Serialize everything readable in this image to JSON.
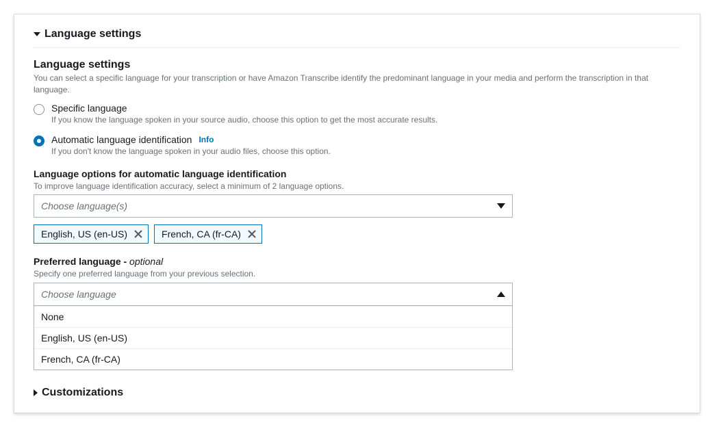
{
  "section": {
    "language_settings_title": "Language settings",
    "customizations_title": "Customizations"
  },
  "language_settings": {
    "heading": "Language settings",
    "description": "You can select a specific language for your transcription or have Amazon Transcribe identify the predominant language in your media and perform the transcription in that language.",
    "radio": {
      "specific": {
        "label": "Specific language",
        "desc": "If you know the language spoken in your source audio, choose this option to get the most accurate results."
      },
      "automatic": {
        "label": "Automatic language identification",
        "info": "Info",
        "desc": "If you don't know the language spoken in your audio files, choose this option."
      }
    }
  },
  "language_options": {
    "label": "Language options for automatic language identification",
    "desc": "To improve language identification accuracy, select a minimum of 2 language options.",
    "placeholder": "Choose language(s)",
    "tokens": [
      {
        "label": "English, US (en-US)"
      },
      {
        "label": "French, CA (fr-CA)"
      }
    ]
  },
  "preferred_language": {
    "label_prefix": "Preferred language - ",
    "label_optional": "optional",
    "desc": "Specify one preferred language from your previous selection.",
    "placeholder": "Choose language",
    "options": [
      "None",
      "English, US (en-US)",
      "French, CA (fr-CA)"
    ]
  }
}
